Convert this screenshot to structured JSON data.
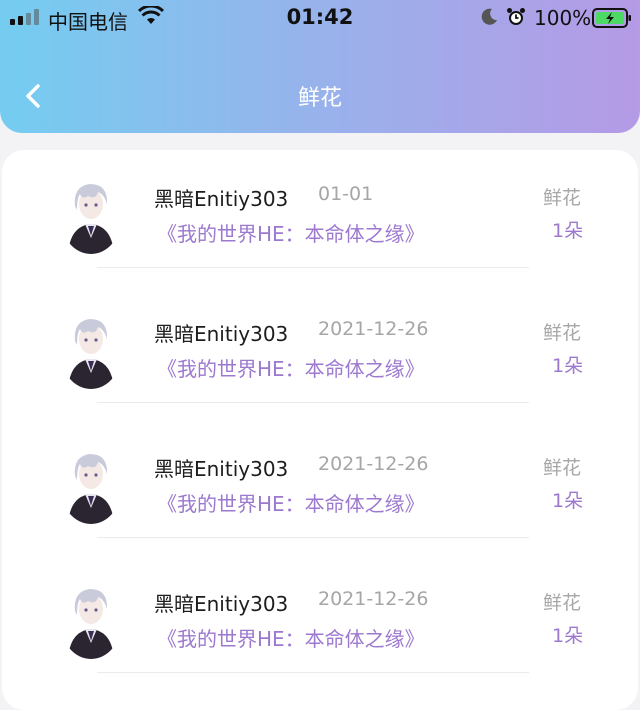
{
  "status_bar": {
    "carrier": "中国电信",
    "time": "01:42",
    "battery": "100%"
  },
  "header": {
    "title": "鲜花"
  },
  "records": [
    {
      "user": "黑暗Enitiy303",
      "date": "01-01",
      "book": "《我的世界HE：本命体之缘》",
      "gift": "鲜花",
      "count": "1朵"
    },
    {
      "user": "黑暗Enitiy303",
      "date": "2021-12-26",
      "book": "《我的世界HE：本命体之缘》",
      "gift": "鲜花",
      "count": "1朵"
    },
    {
      "user": "黑暗Enitiy303",
      "date": "2021-12-26",
      "book": "《我的世界HE：本命体之缘》",
      "gift": "鲜花",
      "count": "1朵"
    },
    {
      "user": "黑暗Enitiy303",
      "date": "2021-12-26",
      "book": "《我的世界HE：本命体之缘》",
      "gift": "鲜花",
      "count": "1朵"
    }
  ],
  "icons": [
    "signal-icon",
    "wifi-icon",
    "moon-icon",
    "alarm-icon",
    "battery-icon",
    "back-arrow-icon",
    "avatar"
  ],
  "colors": {
    "header_start": "#74cdf0",
    "header_end": "#b59ae6",
    "accent": "#9c79cf"
  }
}
